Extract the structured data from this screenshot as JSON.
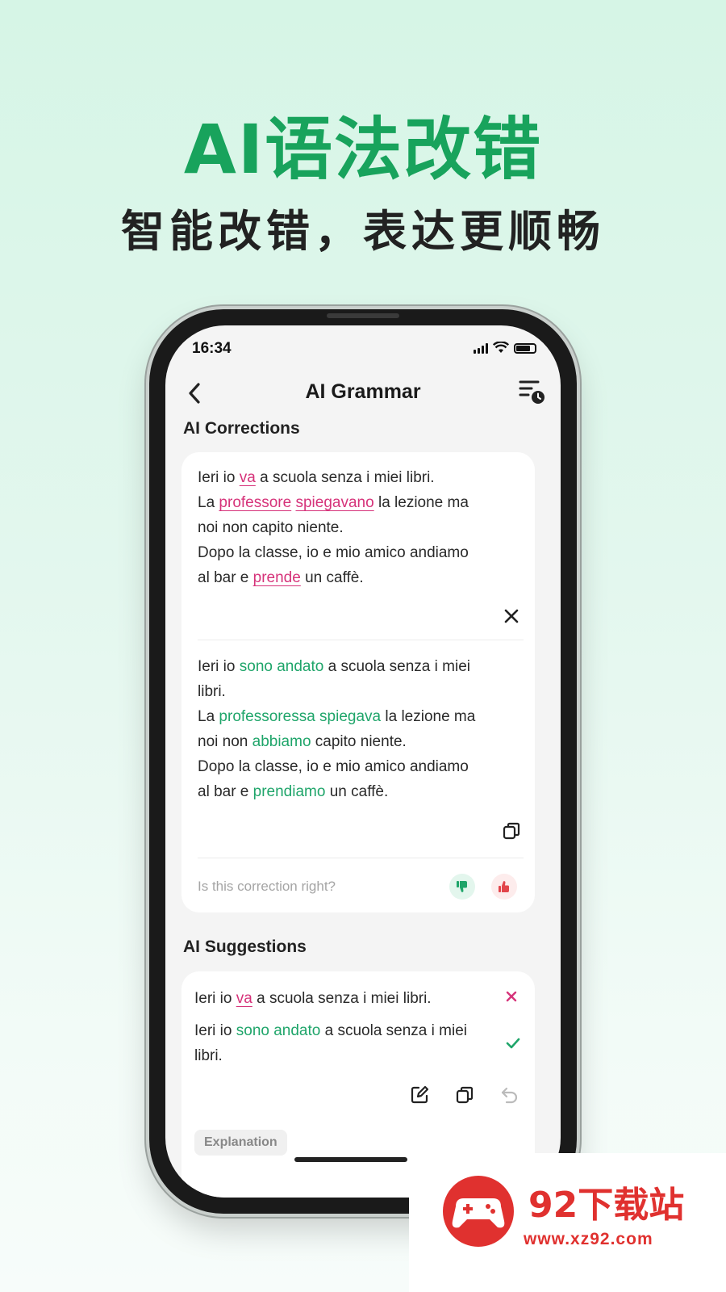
{
  "promo": {
    "title": "AI语法改错",
    "subtitle": "智能改错，表达更顺畅"
  },
  "status_bar": {
    "time": "16:34"
  },
  "nav": {
    "title": "AI Grammar"
  },
  "corrections": {
    "heading": "AI Corrections",
    "original": {
      "l1_a": "Ieri io ",
      "l1_err": "va",
      "l1_b": " a scuola senza i miei libri.",
      "l2_a": "La ",
      "l2_err1": "professore",
      "l2_sp": " ",
      "l2_err2": "spiegavano",
      "l2_b": " la lezione ma",
      "l3": "noi non capito niente.",
      "l4": "Dopo la classe, io e mio amico andiamo",
      "l5_a": "al bar e ",
      "l5_err": "prende",
      "l5_b": " un caffè."
    },
    "corrected": {
      "l1_a": "Ieri io ",
      "l1_fix": "sono andato",
      "l1_b": " a scuola senza i miei",
      "l2": "libri.",
      "l3_a": "La ",
      "l3_fix": "professoressa spiegava",
      "l3_b": " la lezione ma",
      "l4_a": "noi non ",
      "l4_fix": "abbiamo",
      "l4_b": " capito niente.",
      "l5": "Dopo la classe, io e mio amico andiamo",
      "l6_a": "al bar e ",
      "l6_fix": "prendiamo",
      "l6_b": " un caffè."
    },
    "feedback_question": "Is this correction right?"
  },
  "suggestions": {
    "heading": "AI Suggestions",
    "item": {
      "wrong_a": "Ieri io ",
      "wrong_err": "va",
      "wrong_b": " a scuola senza i miei libri.",
      "right_a": "Ieri io ",
      "right_fix": "sono andato",
      "right_b": " a scuola senza i miei",
      "right_c": "libri."
    },
    "explanation_label": "Explanation"
  },
  "watermark": {
    "brand": "92下载站",
    "url": "www.xz92.com"
  },
  "colors": {
    "accent": "#18a35c",
    "error": "#d6337a",
    "fix": "#1fa56a"
  },
  "icons": [
    "back-icon",
    "history-icon",
    "close-icon",
    "copy-icon",
    "thumb-down-icon",
    "thumb-up-icon",
    "edit-icon",
    "undo-icon",
    "check-icon"
  ]
}
